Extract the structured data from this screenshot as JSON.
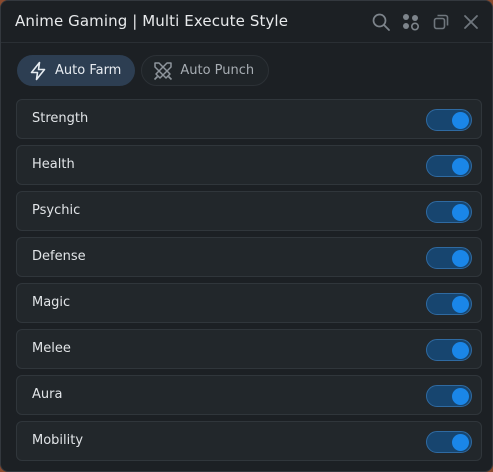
{
  "window": {
    "title": "Anime Gaming | Multi Execute Style",
    "titlebar_icons": [
      "search-icon",
      "settings-dots-icon",
      "restore-icon",
      "close-icon"
    ]
  },
  "tabs": [
    {
      "label": "Auto Farm",
      "icon": "lightning-icon",
      "active": true
    },
    {
      "label": "Auto Punch",
      "icon": "crossed-swords-icon",
      "active": false
    }
  ],
  "toggles": [
    {
      "label": "Strength",
      "on": true
    },
    {
      "label": "Health",
      "on": true
    },
    {
      "label": "Psychic",
      "on": true
    },
    {
      "label": "Defense",
      "on": true
    },
    {
      "label": "Magic",
      "on": true
    },
    {
      "label": "Melee",
      "on": true
    },
    {
      "label": "Aura",
      "on": true
    },
    {
      "label": "Mobility",
      "on": true
    }
  ],
  "colors": {
    "accent": "#1a86e8",
    "toggle_track_on": "#17456f",
    "active_tab": "#2d3e52",
    "background": "#1c2024"
  }
}
